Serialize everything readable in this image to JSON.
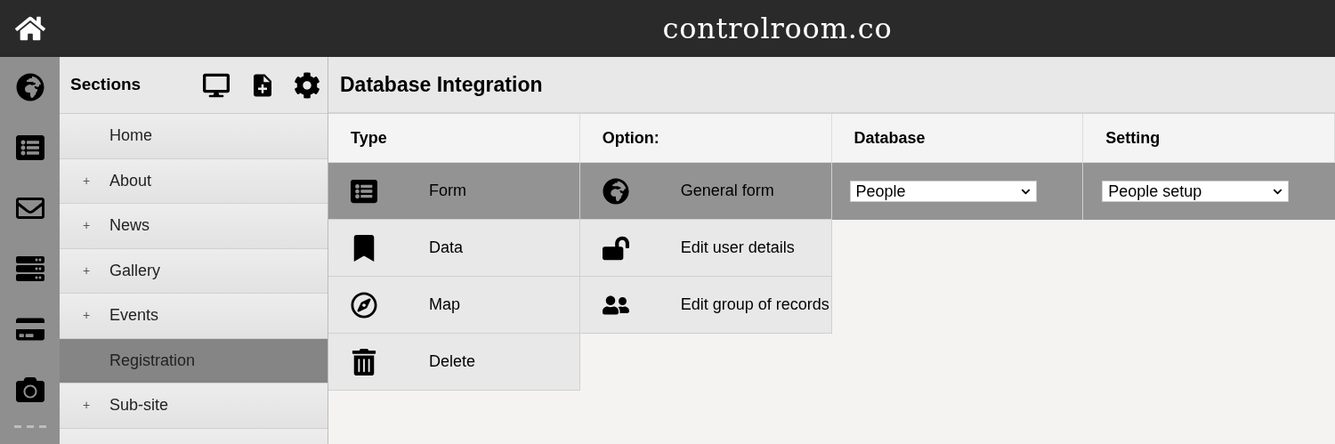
{
  "header": {
    "logo": "controlroom.co"
  },
  "sidebar": {
    "title": "Sections",
    "items": [
      {
        "label": "Home",
        "expandable": false,
        "selected": false
      },
      {
        "label": "About",
        "expandable": true,
        "selected": false
      },
      {
        "label": "News",
        "expandable": true,
        "selected": false
      },
      {
        "label": "Gallery",
        "expandable": true,
        "selected": false
      },
      {
        "label": "Events",
        "expandable": true,
        "selected": false
      },
      {
        "label": "Registration",
        "expandable": false,
        "selected": true
      },
      {
        "label": "Sub-site",
        "expandable": true,
        "selected": false
      },
      {
        "selected": false
      }
    ],
    "expand_marker": "+"
  },
  "main": {
    "title": "Database Integration",
    "columns": [
      "Type",
      "Option:",
      "Database",
      "Setting"
    ],
    "types": [
      {
        "kind": "form",
        "label": "Form",
        "selected": true
      },
      {
        "kind": "data",
        "label": "Data",
        "selected": false
      },
      {
        "kind": "map",
        "label": "Map",
        "selected": false
      },
      {
        "kind": "delete",
        "label": "Delete",
        "selected": false
      }
    ],
    "options": [
      {
        "kind": "general",
        "label": "General form",
        "selected": true
      },
      {
        "kind": "user",
        "label": "Edit user details",
        "selected": false
      },
      {
        "kind": "group",
        "label": "Edit group of records",
        "selected": false
      }
    ],
    "database": {
      "value": "People"
    },
    "setting": {
      "value": "People setup"
    }
  }
}
